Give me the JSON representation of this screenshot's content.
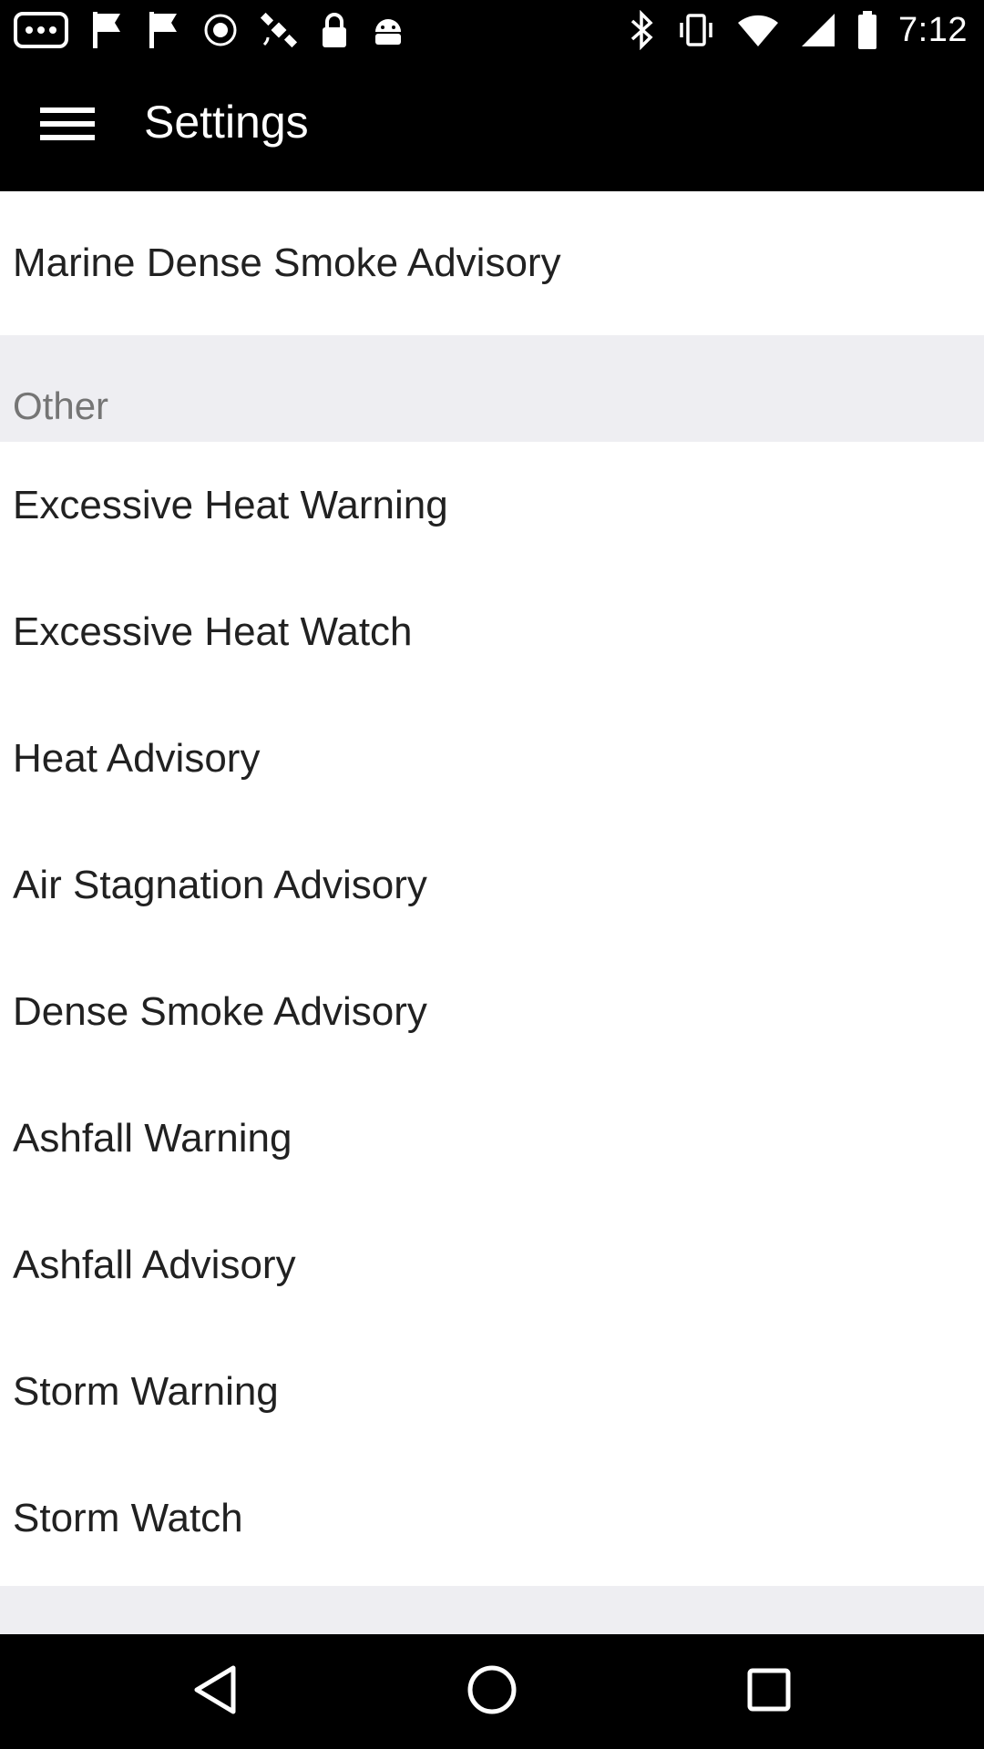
{
  "status_bar": {
    "time": "7:12",
    "left_icons": [
      "messages-icon",
      "notification-flag-icon",
      "notification-flag-icon",
      "radio-icon",
      "satellite-icon",
      "lock-icon",
      "android-icon"
    ],
    "right_icons": [
      "bluetooth-icon",
      "vibrate-icon",
      "wifi-icon",
      "signal-icon",
      "battery-icon"
    ]
  },
  "app_bar": {
    "menu_icon": "hamburger-menu-icon",
    "title": "Settings"
  },
  "content": {
    "top_item": "Marine Dense Smoke Advisory",
    "section_header": "Other",
    "items": [
      "Excessive Heat Warning",
      "Excessive Heat Watch",
      "Heat Advisory",
      "Air Stagnation Advisory",
      "Dense Smoke Advisory",
      "Ashfall Warning",
      "Ashfall Advisory",
      "Storm Warning",
      "Storm Watch"
    ]
  },
  "nav_bar": {
    "icons": [
      "back-icon",
      "home-icon",
      "recents-icon"
    ]
  },
  "colors": {
    "app_bar_background": "#000000",
    "content_background": "#ffffff",
    "section_background": "#eeeef2",
    "item_text": "#212121",
    "section_text": "#757575"
  }
}
